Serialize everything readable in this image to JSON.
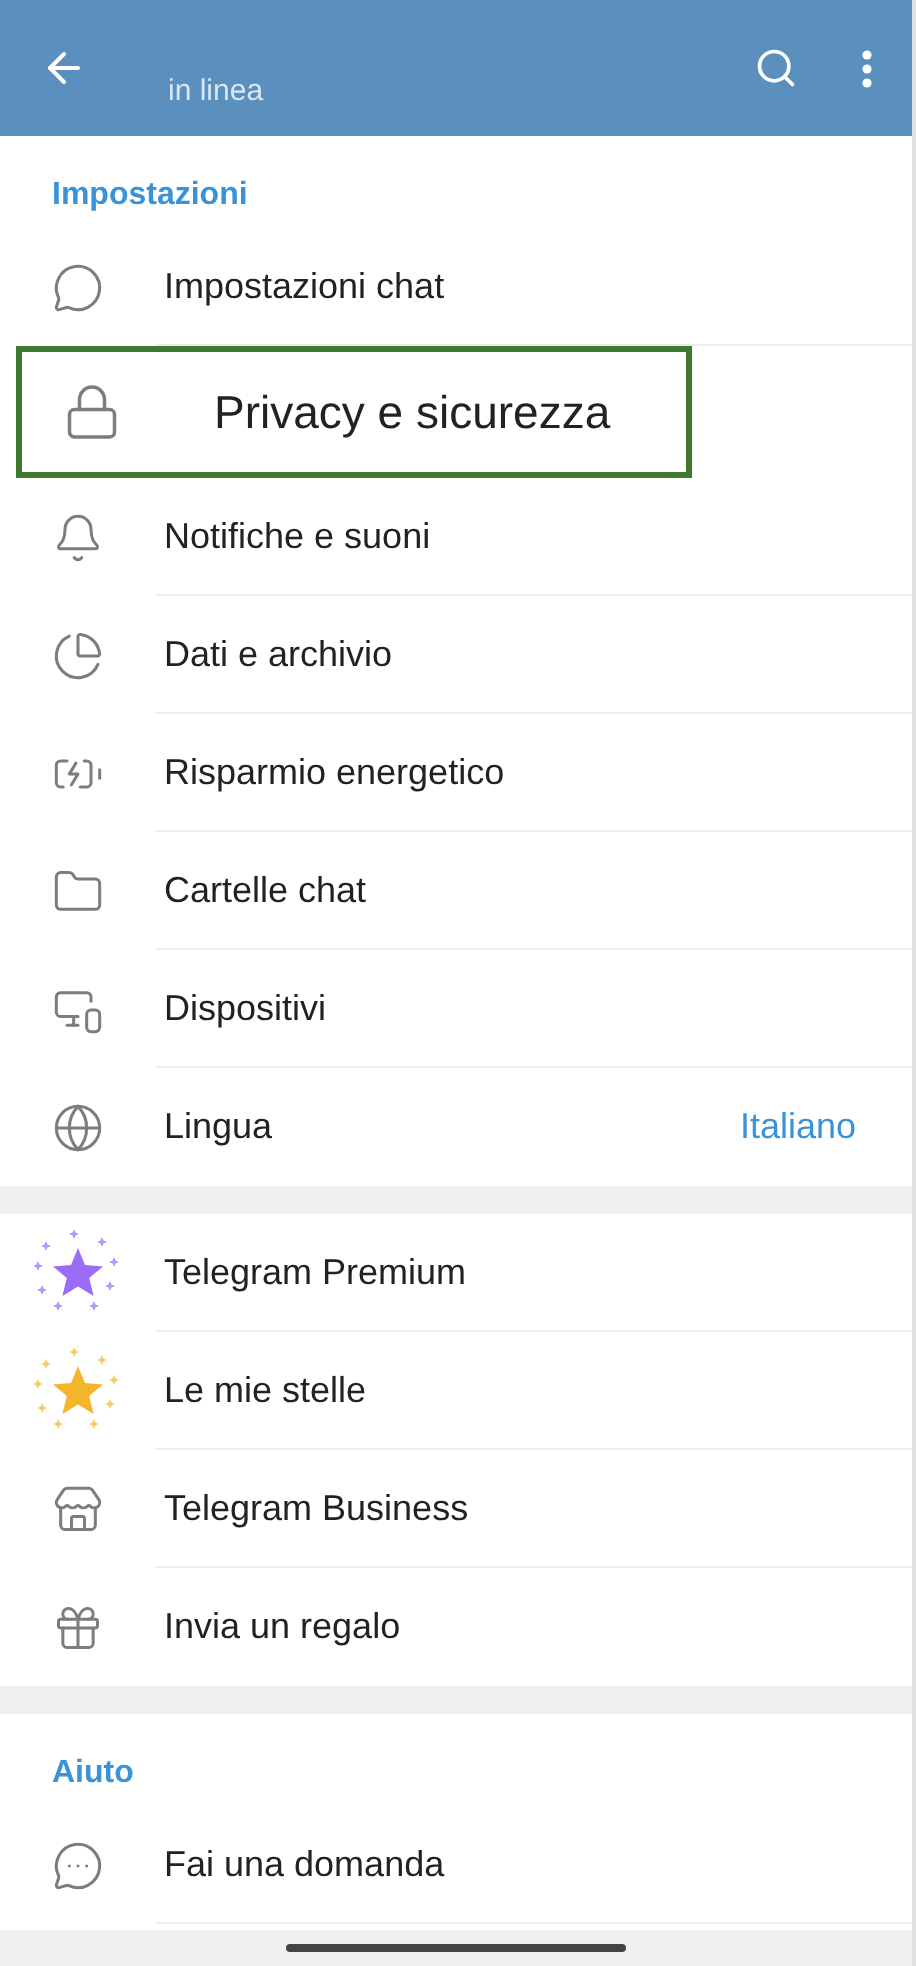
{
  "header": {
    "subtitle": "in linea"
  },
  "sections": [
    {
      "title": "Impostazioni",
      "items": [
        {
          "kind": "chat",
          "label": "Impostazioni chat",
          "highlighted": false
        },
        {
          "kind": "lock",
          "label": "Privacy e sicurezza",
          "highlighted": true
        },
        {
          "kind": "bell",
          "label": "Notifiche e suoni",
          "highlighted": false
        },
        {
          "kind": "pie",
          "label": "Dati e archivio",
          "highlighted": false
        },
        {
          "kind": "battery",
          "label": "Risparmio energetico",
          "highlighted": false
        },
        {
          "kind": "folder",
          "label": "Cartelle chat",
          "highlighted": false
        },
        {
          "kind": "devices",
          "label": "Dispositivi",
          "highlighted": false
        },
        {
          "kind": "globe",
          "label": "Lingua",
          "value": "Italiano",
          "highlighted": false
        }
      ]
    },
    {
      "items": [
        {
          "kind": "sparkle-star",
          "label": "Telegram Premium",
          "color": "#9b6cf5",
          "highlighted": false
        },
        {
          "kind": "sparkle-star",
          "label": "Le mie stelle",
          "color": "#f5b52a",
          "highlighted": false
        },
        {
          "kind": "store",
          "label": "Telegram Business",
          "highlighted": false
        },
        {
          "kind": "gift",
          "label": "Invia un regalo",
          "highlighted": false
        }
      ]
    },
    {
      "title": "Aiuto",
      "items": [
        {
          "kind": "question",
          "label": "Fai una domanda",
          "highlighted": false
        }
      ]
    }
  ]
}
